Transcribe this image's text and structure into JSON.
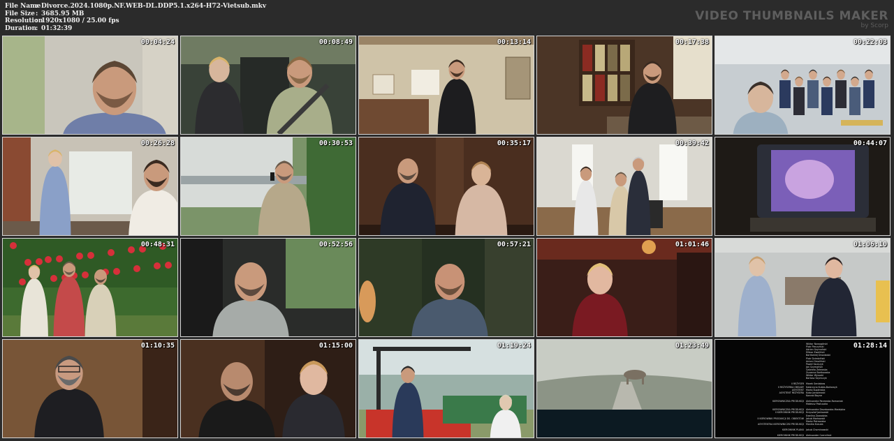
{
  "file_info": {
    "rows": [
      {
        "label": "File Name",
        "value": "Divorce.2024.1080p.NF.WEB-DL.DDP5.1.x264-H72-Vietsub.mkv"
      },
      {
        "label": "File Size",
        "value": "3685.95 MB"
      },
      {
        "label": "Resolution",
        "value": "1920x1080 / 25.00 fps"
      },
      {
        "label": "Duration",
        "value": "01:32:39"
      }
    ],
    "separator": ":"
  },
  "brand": {
    "title": "VIDEO THUMBNAILS MAKER",
    "subtitle": "by Scorp"
  },
  "thumbnails": [
    {
      "time": "00:04:24"
    },
    {
      "time": "00:08:49"
    },
    {
      "time": "00:13:14"
    },
    {
      "time": "00:17:38"
    },
    {
      "time": "00:22:03"
    },
    {
      "time": "00:26:28"
    },
    {
      "time": "00:30:53"
    },
    {
      "time": "00:35:17"
    },
    {
      "time": "00:39:42"
    },
    {
      "time": "00:44:07"
    },
    {
      "time": "00:48:31"
    },
    {
      "time": "00:52:56"
    },
    {
      "time": "00:57:21"
    },
    {
      "time": "01:01:46"
    },
    {
      "time": "01:06:10"
    },
    {
      "time": "01:10:35"
    },
    {
      "time": "01:15:00"
    },
    {
      "time": "01:19:24"
    },
    {
      "time": "01:23:49"
    },
    {
      "time": "01:28:14"
    }
  ],
  "credits": [
    {
      "role": "",
      "name": "Wiktor Nowogórski"
    },
    {
      "role": "",
      "name": "Piotr Pieczyński"
    },
    {
      "role": "",
      "name": "Adrian Szymański"
    },
    {
      "role": "",
      "name": "Milosz Zwoliński"
    },
    {
      "role": "",
      "name": "Bartłomiej Drozdalski"
    },
    {
      "role": "",
      "name": "Piotr Dziedziński"
    },
    {
      "role": "",
      "name": "Antoni Smoliński"
    },
    {
      "role": "",
      "name": "Paweł Szulczyk"
    },
    {
      "role": "",
      "name": "Jan Szymański"
    },
    {
      "role": "",
      "name": "Gabriela Żelewska"
    },
    {
      "role": "",
      "name": "Zuzanna Bartkowska"
    },
    {
      "role": "",
      "name": "Wiktor Wysocki"
    },
    {
      "role": "",
      "name": "Bartosz Szymczyk"
    },
    {
      "role": "",
      "name": ""
    },
    {
      "role": "II REŻYSER",
      "name": "Marek Serdakow"
    },
    {
      "role": "II REŻYSERKA OBSADY",
      "name": "Katarzyna Kubka-Borkowyk"
    },
    {
      "role": "ASYSTENT",
      "name": "Marta Kuplenska"
    },
    {
      "role": "ASYSTENT REŻYSERA",
      "name": "Kuba Jarosiewski"
    },
    {
      "role": "",
      "name": "Konrad Bayne"
    },
    {
      "role": "",
      "name": ""
    },
    {
      "role": "KIEROWNICZKA PRODUKCJI",
      "name": "Aleksandra Pacewska-Romaniak"
    },
    {
      "role": "",
      "name": "Mateusz Pastuszka"
    },
    {
      "role": "",
      "name": ""
    },
    {
      "role": "KIEROWNICZKA PRODUKCJI",
      "name": "Aleksandra Drozdowska-Madejska"
    },
    {
      "role": "II KIEROWNIK PRODUKCJI",
      "name": "Krzysztof Jankowski"
    },
    {
      "role": "",
      "name": "Ewelina Zawadzka"
    },
    {
      "role": "II KIEROWNIK PRODUKCJI DS. OBIEKTÓW",
      "name": "Jakub Markowski"
    },
    {
      "role": "",
      "name": "Marta Piotrowska"
    },
    {
      "role": "ASYSTENTKA KIEROWNICZKI PRODUKCJI",
      "name": "Monika Krauda"
    },
    {
      "role": "",
      "name": ""
    },
    {
      "role": "KIEROWNIK PLANU",
      "name": "Jakub Chominowski"
    },
    {
      "role": "",
      "name": ""
    },
    {
      "role": "KIEROWNIK PRODUKCJI",
      "name": "Aleksander Czerniński"
    }
  ]
}
